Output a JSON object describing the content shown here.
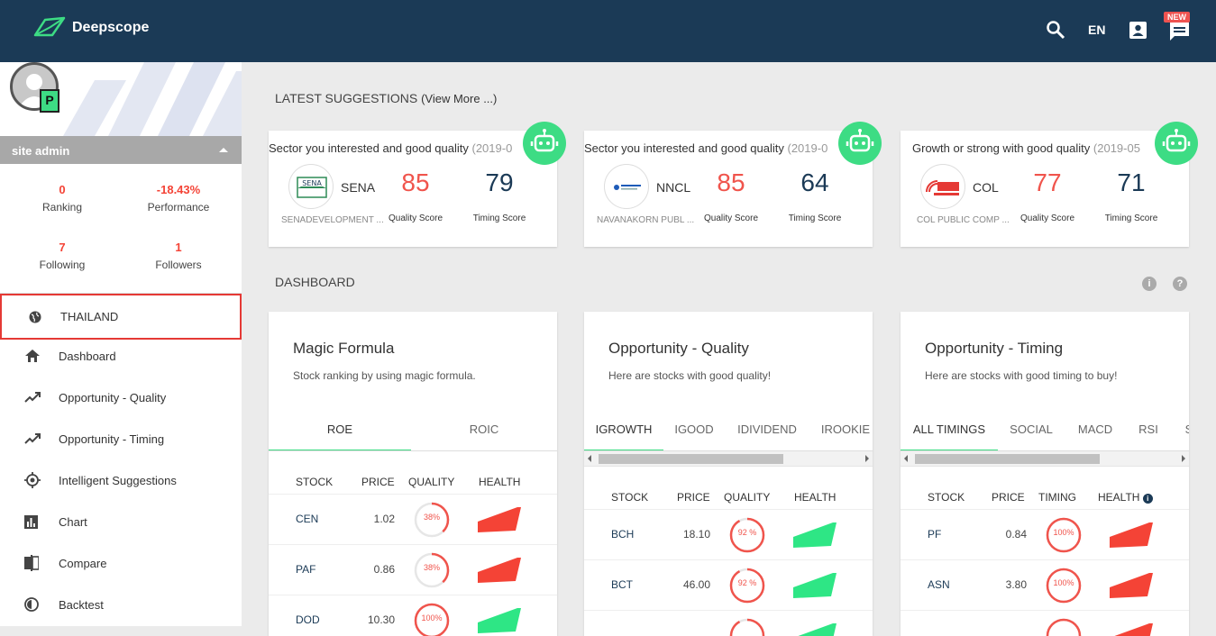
{
  "app": {
    "title": "Deepscope"
  },
  "topbar": {
    "lang": "EN",
    "new_badge": "NEW"
  },
  "user": {
    "name": "site admin",
    "badge": "P"
  },
  "stats": [
    {
      "value": "0",
      "label": "Ranking"
    },
    {
      "value": "-18.43%",
      "label": "Performance"
    },
    {
      "value": "7",
      "label": "Following"
    },
    {
      "value": "1",
      "label": "Followers"
    }
  ],
  "nav": {
    "market": "THAILAND",
    "items": [
      {
        "label": "Dashboard",
        "icon": "home-icon"
      },
      {
        "label": "Opportunity - Quality",
        "icon": "trending-up-icon"
      },
      {
        "label": "Opportunity - Timing",
        "icon": "trending-up-icon"
      },
      {
        "label": "Intelligent Suggestions",
        "icon": "target-icon"
      },
      {
        "label": "Chart",
        "icon": "bar-chart-icon"
      },
      {
        "label": "Compare",
        "icon": "compare-icon"
      },
      {
        "label": "Backtest",
        "icon": "backtest-icon"
      }
    ]
  },
  "latest": {
    "title": "LATEST SUGGESTIONS",
    "view_more": "(View More ...)",
    "cards": [
      {
        "heading": "Sector you interested and good quality",
        "date": "(2019-0",
        "ticker": "SENA",
        "name": "SENADEVELOPMENT ...",
        "quality": "85",
        "quality_label": "Quality Score",
        "timing": "79",
        "timing_label": "Timing Score"
      },
      {
        "heading": "Sector you interested and good quality",
        "date": "(2019-0",
        "ticker": "NNCL",
        "name": "NAVANAKORN PUBL ...",
        "quality": "85",
        "quality_label": "Quality Score",
        "timing": "64",
        "timing_label": "Timing Score"
      },
      {
        "heading": "Growth or strong with good quality",
        "date": "(2019-05",
        "ticker": "COL",
        "name": "COL PUBLIC COMP ...",
        "quality": "77",
        "quality_label": "Quality Score",
        "timing": "71",
        "timing_label": "Timing Score"
      }
    ]
  },
  "dashboard": {
    "title": "DASHBOARD",
    "cards": [
      {
        "title": "Magic Formula",
        "desc": "Stock ranking by using magic formula.",
        "tabs": [
          "ROE",
          "ROIC"
        ],
        "headers": [
          "STOCK",
          "PRICE",
          "QUALITY",
          "HEALTH"
        ],
        "rows": [
          {
            "stock": "CEN",
            "price": "1.02",
            "score": "38%",
            "frac": 0.38,
            "health": "red"
          },
          {
            "stock": "PAF",
            "price": "0.86",
            "score": "38%",
            "frac": 0.38,
            "health": "red"
          },
          {
            "stock": "DOD",
            "price": "10.30",
            "score": "100%",
            "frac": 1.0,
            "health": "green"
          }
        ]
      },
      {
        "title": "Opportunity - Quality",
        "desc": "Here are stocks with good quality!",
        "tabs": [
          "IGROWTH",
          "IGOOD",
          "IDIVIDEND",
          "IROOKIE"
        ],
        "headers": [
          "STOCK",
          "PRICE",
          "QUALITY",
          "HEALTH"
        ],
        "rows": [
          {
            "stock": "BCH",
            "price": "18.10",
            "score": "92 %",
            "frac": 0.92,
            "health": "green"
          },
          {
            "stock": "BCT",
            "price": "46.00",
            "score": "92 %",
            "frac": 0.92,
            "health": "green"
          },
          {
            "stock": "",
            "price": "",
            "score": "",
            "frac": 0.92,
            "health": "green"
          }
        ]
      },
      {
        "title": "Opportunity - Timing",
        "desc": "Here are stocks with good timing to buy!",
        "tabs": [
          "ALL TIMINGS",
          "SOCIAL",
          "MACD",
          "RSI",
          "S"
        ],
        "headers": [
          "STOCK",
          "PRICE",
          "TIMING",
          "HEALTH"
        ],
        "rows": [
          {
            "stock": "PF",
            "price": "0.84",
            "score": "100%",
            "frac": 1.0,
            "health": "red"
          },
          {
            "stock": "ASN",
            "price": "3.80",
            "score": "100%",
            "frac": 1.0,
            "health": "red"
          },
          {
            "stock": "",
            "price": "",
            "score": "",
            "frac": 1.0,
            "health": "red"
          }
        ]
      }
    ]
  },
  "colors": {
    "header": "#1b3a56",
    "accent": "#3ddc84",
    "danger": "#f0544c",
    "health_red": "#f44336",
    "health_green": "#2ee685"
  }
}
